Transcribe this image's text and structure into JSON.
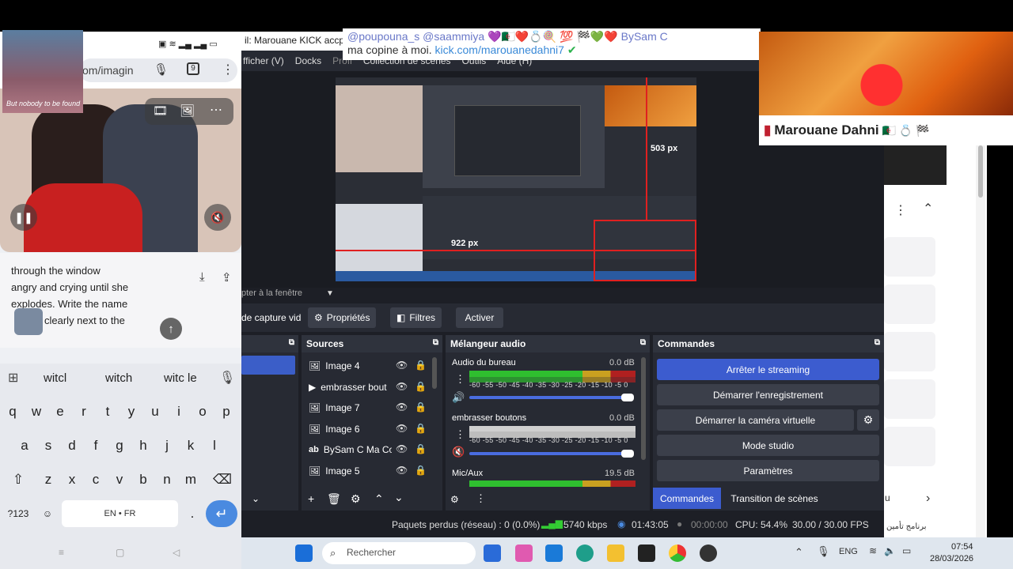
{
  "obs": {
    "title": "il: Marouane KICK accpetab",
    "menu": [
      "fficher (V)",
      "Docks",
      "Profi",
      "Collection de scènes",
      "Outils",
      "Aide (H)"
    ],
    "preview_label": "pter à la fenêtre",
    "preview_readouts": [
      "503 px",
      "922 px"
    ],
    "toolbar": {
      "source_name": "de capture vid",
      "properties": "Propriétés",
      "filters": "Filtres",
      "activate": "Activer"
    },
    "sources": {
      "title": "Sources",
      "items": [
        "Image 4",
        "embrasser bout",
        "Image 7",
        "Image 6",
        "BySam C Ma Co",
        "Image 5"
      ]
    },
    "mixer": {
      "title": "Mélangeur audio",
      "ticks": "-60 -55 -50 -45 -40 -35 -30 -25 -20 -15 -10 -5 0",
      "channels": [
        {
          "name": "Audio du bureau",
          "db": "0.0 dB"
        },
        {
          "name": "embrasser boutons",
          "db": "0.0 dB"
        },
        {
          "name": "Mic/Aux",
          "db": "19.5 dB"
        }
      ]
    },
    "commands": {
      "title": "Commandes",
      "buttons": [
        "Arrêter le streaming",
        "Démarrer l'enregistrement",
        "Démarrer la caméra virtuelle",
        "Mode studio",
        "Paramètres"
      ],
      "tabs": [
        "Commandes",
        "Transition de scènes"
      ]
    },
    "status": {
      "dropped": "Paquets perdus (réseau) : 0 (0.0%)",
      "bitrate": "5740 kbps",
      "stream_time": "01:43:05",
      "rec_time": "00:00:00",
      "cpu": "CPU: 54.4%",
      "fps": "30.00 / 30.00 FPS"
    }
  },
  "phone": {
    "url_fragment": "om/imagin",
    "webcam_caption": "But nobody to be found",
    "chat_text": [
      "through the window",
      "angry and crying until she",
      "explodes. Write the name",
      "clearly next to the"
    ],
    "suggestions": [
      "witcl",
      "witch",
      "witc le"
    ],
    "rows": [
      [
        "q",
        "w",
        "e",
        "r",
        "t",
        "y",
        "u",
        "i",
        "o",
        "p"
      ],
      [
        "a",
        "s",
        "d",
        "f",
        "g",
        "h",
        "j",
        "k",
        "l"
      ],
      [
        "z",
        "x",
        "c",
        "v",
        "b",
        "n",
        "m"
      ]
    ],
    "num_key": "?123",
    "space_label": "EN • FR",
    "period": "."
  },
  "overlay": {
    "chat_line1": "@poupouna_s @saammiya 💜🇩🇿❤️💍🍭 💯 🏁💚❤️ BySam C",
    "chat_line2_prefix": "ma copine à moi. ",
    "chat_link": "kick.com/marouanedahni7",
    "name_label": "Marouane Dahni"
  },
  "taskbar": {
    "search_placeholder": "Rechercher",
    "lang": "ENG",
    "time": "07:54",
    "date": "28/03/2026"
  },
  "browser": {
    "bottom_text": "برنامج تأمين",
    "side_label": "u"
  }
}
